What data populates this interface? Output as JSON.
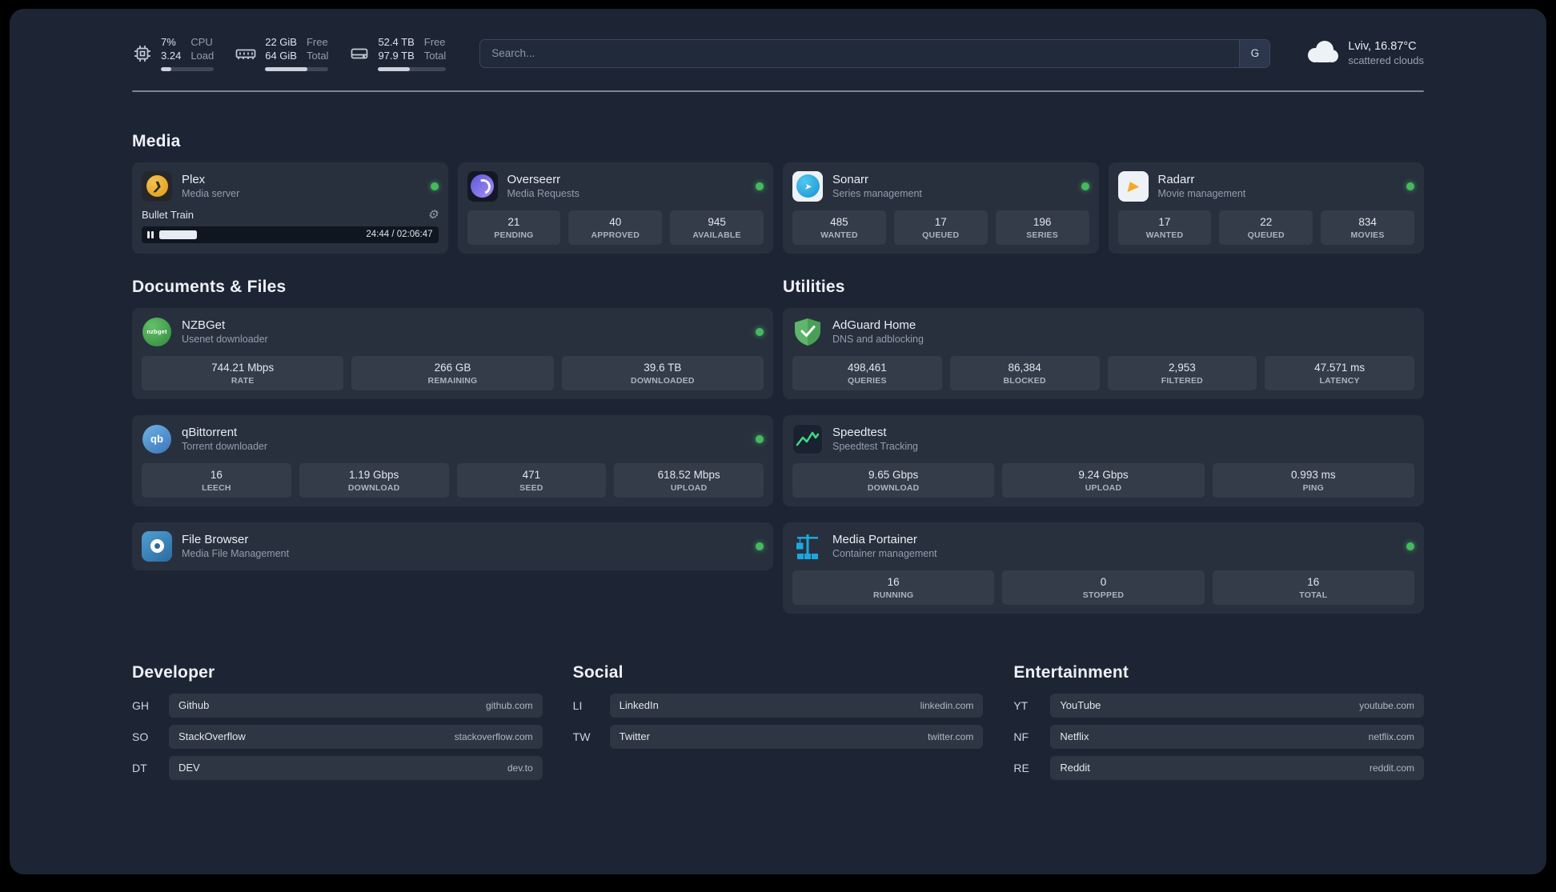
{
  "topbar": {
    "cpu": {
      "percent": "7%",
      "load": "3.24",
      "label_top": "CPU",
      "label_bottom": "Load",
      "bar_fill": 20
    },
    "memory": {
      "free": "22 GiB",
      "total": "64 GiB",
      "label_top": "Free",
      "label_bottom": "Total",
      "bar_fill": 66
    },
    "disk": {
      "free": "52.4 TB",
      "total": "97.9 TB",
      "label_top": "Free",
      "label_bottom": "Total",
      "bar_fill": 47
    },
    "search": {
      "placeholder": "Search...",
      "provider": "G"
    },
    "weather": {
      "location": "Lviv, 16.87°C",
      "condition": "scattered clouds"
    }
  },
  "sections": {
    "media": {
      "title": "Media",
      "cards": [
        {
          "name": "Plex",
          "subtitle": "Media server",
          "online": true,
          "player": {
            "track": "Bullet Train",
            "time": "24:44 / 02:06:47",
            "progress": 19
          }
        },
        {
          "name": "Overseerr",
          "subtitle": "Media Requests",
          "online": true,
          "stats": [
            {
              "value": "21",
              "label": "PENDING"
            },
            {
              "value": "40",
              "label": "APPROVED"
            },
            {
              "value": "945",
              "label": "AVAILABLE"
            }
          ]
        },
        {
          "name": "Sonarr",
          "subtitle": "Series management",
          "online": true,
          "stats": [
            {
              "value": "485",
              "label": "WANTED"
            },
            {
              "value": "17",
              "label": "QUEUED"
            },
            {
              "value": "196",
              "label": "SERIES"
            }
          ]
        },
        {
          "name": "Radarr",
          "subtitle": "Movie management",
          "online": true,
          "stats": [
            {
              "value": "17",
              "label": "WANTED"
            },
            {
              "value": "22",
              "label": "QUEUED"
            },
            {
              "value": "834",
              "label": "MOVIES"
            }
          ]
        }
      ]
    },
    "documents": {
      "title": "Documents & Files",
      "cards": [
        {
          "name": "NZBGet",
          "subtitle": "Usenet downloader",
          "online": true,
          "stats": [
            {
              "value": "744.21 Mbps",
              "label": "RATE"
            },
            {
              "value": "266 GB",
              "label": "REMAINING"
            },
            {
              "value": "39.6 TB",
              "label": "DOWNLOADED"
            }
          ]
        },
        {
          "name": "qBittorrent",
          "subtitle": "Torrent downloader",
          "online": true,
          "stats": [
            {
              "value": "16",
              "label": "LEECH"
            },
            {
              "value": "1.19 Gbps",
              "label": "DOWNLOAD"
            },
            {
              "value": "471",
              "label": "SEED"
            },
            {
              "value": "618.52 Mbps",
              "label": "UPLOAD"
            }
          ]
        },
        {
          "name": "File Browser",
          "subtitle": "Media File Management",
          "online": true
        }
      ]
    },
    "utilities": {
      "title": "Utilities",
      "cards": [
        {
          "name": "AdGuard Home",
          "subtitle": "DNS and adblocking",
          "online": false,
          "stats": [
            {
              "value": "498,461",
              "label": "QUERIES"
            },
            {
              "value": "86,384",
              "label": "BLOCKED"
            },
            {
              "value": "2,953",
              "label": "FILTERED"
            },
            {
              "value": "47.571 ms",
              "label": "LATENCY"
            }
          ]
        },
        {
          "name": "Speedtest",
          "subtitle": "Speedtest Tracking",
          "online": false,
          "stats": [
            {
              "value": "9.65 Gbps",
              "label": "DOWNLOAD"
            },
            {
              "value": "9.24 Gbps",
              "label": "UPLOAD"
            },
            {
              "value": "0.993 ms",
              "label": "PING"
            }
          ]
        },
        {
          "name": "Media Portainer",
          "subtitle": "Container management",
          "online": true,
          "stats": [
            {
              "value": "16",
              "label": "RUNNING"
            },
            {
              "value": "0",
              "label": "STOPPED"
            },
            {
              "value": "16",
              "label": "TOTAL"
            }
          ]
        }
      ]
    }
  },
  "bookmarks": [
    {
      "title": "Developer",
      "items": [
        {
          "abbr": "GH",
          "name": "Github",
          "url": "github.com"
        },
        {
          "abbr": "SO",
          "name": "StackOverflow",
          "url": "stackoverflow.com"
        },
        {
          "abbr": "DT",
          "name": "DEV",
          "url": "dev.to"
        }
      ]
    },
    {
      "title": "Social",
      "items": [
        {
          "abbr": "LI",
          "name": "LinkedIn",
          "url": "linkedin.com"
        },
        {
          "abbr": "TW",
          "name": "Twitter",
          "url": "twitter.com"
        }
      ]
    },
    {
      "title": "Entertainment",
      "items": [
        {
          "abbr": "YT",
          "name": "YouTube",
          "url": "youtube.com"
        },
        {
          "abbr": "NF",
          "name": "Netflix",
          "url": "netflix.com"
        },
        {
          "abbr": "RE",
          "name": "Reddit",
          "url": "reddit.com"
        }
      ]
    }
  ],
  "icon_text": {
    "nzbget": "nzbget",
    "qbittorrent": "qb"
  },
  "colors": {
    "background": "#1d2534",
    "status_online": "#46b95f",
    "plex": "#e5a00d",
    "overseerr": "#7b5ee0",
    "sonarr": "#35c5f4",
    "radarr": "#f9a825",
    "nzbget": "#4caf50",
    "qbittorrent": "#5b9bd5",
    "filebrowser": "#4f9fd0",
    "adguard": "#5fb56a",
    "speedtest_line": "#3ddc84",
    "portainer": "#1ba8e0"
  }
}
